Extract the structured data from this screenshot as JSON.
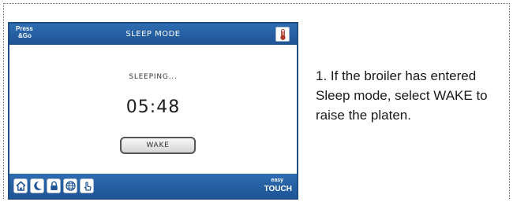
{
  "screen": {
    "header": {
      "logo_line1": "Press",
      "logo_line2": "&Go",
      "title": "SLEEP MODE",
      "thermometer_icon": "thermometer-icon"
    },
    "main": {
      "status": "SLEEPING...",
      "timer": "05:48",
      "wake_label": "WAKE"
    },
    "footer": {
      "nav_icons": [
        "home-icon",
        "moon-icon",
        "lock-icon",
        "globe-icon",
        "hand-pointer-icon"
      ],
      "brand_line1": "easy",
      "brand_line2": "TOUCH"
    },
    "colors": {
      "bar_blue": "#2e6cb0",
      "bar_blue_dark": "#1e5496",
      "thermometer_red": "#c0392b"
    }
  },
  "instruction": {
    "text": "1.  If the broiler has entered Sleep mode, select WAKE to raise the platen."
  }
}
